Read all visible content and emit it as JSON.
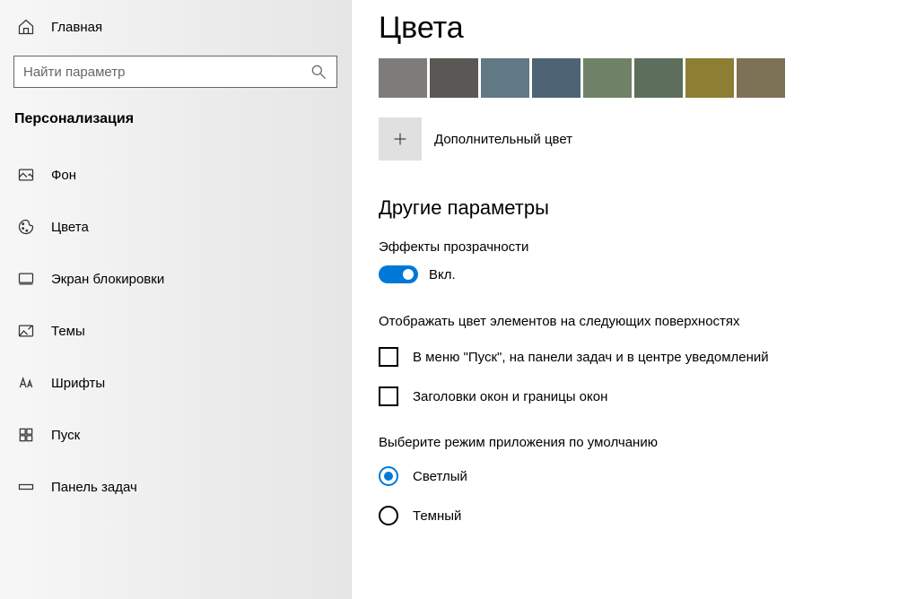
{
  "sidebar": {
    "home": "Главная",
    "searchPlaceholder": "Найти параметр",
    "sectionTitle": "Персонализация",
    "items": [
      {
        "label": "Фон"
      },
      {
        "label": "Цвета"
      },
      {
        "label": "Экран блокировки"
      },
      {
        "label": "Темы"
      },
      {
        "label": "Шрифты"
      },
      {
        "label": "Пуск"
      },
      {
        "label": "Панель задач"
      }
    ]
  },
  "main": {
    "title": "Цвета",
    "swatches": [
      "#7e7c7b",
      "#5a5855",
      "#617885",
      "#4e6475",
      "#6f8267",
      "#5d6e5d",
      "#8c7e32",
      "#7d7256"
    ],
    "moreColorLabel": "Дополнительный цвет",
    "otherParamsHeader": "Другие параметры",
    "transparencyLabel": "Эффекты прозрачности",
    "toggleOnLabel": "Вкл.",
    "surfacesHeader": "Отображать цвет элементов на следующих поверхностях",
    "checkboxes": [
      "В меню \"Пуск\", на панели задач и в центре уведомлений",
      "Заголовки окон и границы окон"
    ],
    "appModeHeader": "Выберите режим приложения по умолчанию",
    "radios": [
      {
        "label": "Светлый",
        "selected": true
      },
      {
        "label": "Темный",
        "selected": false
      }
    ]
  }
}
